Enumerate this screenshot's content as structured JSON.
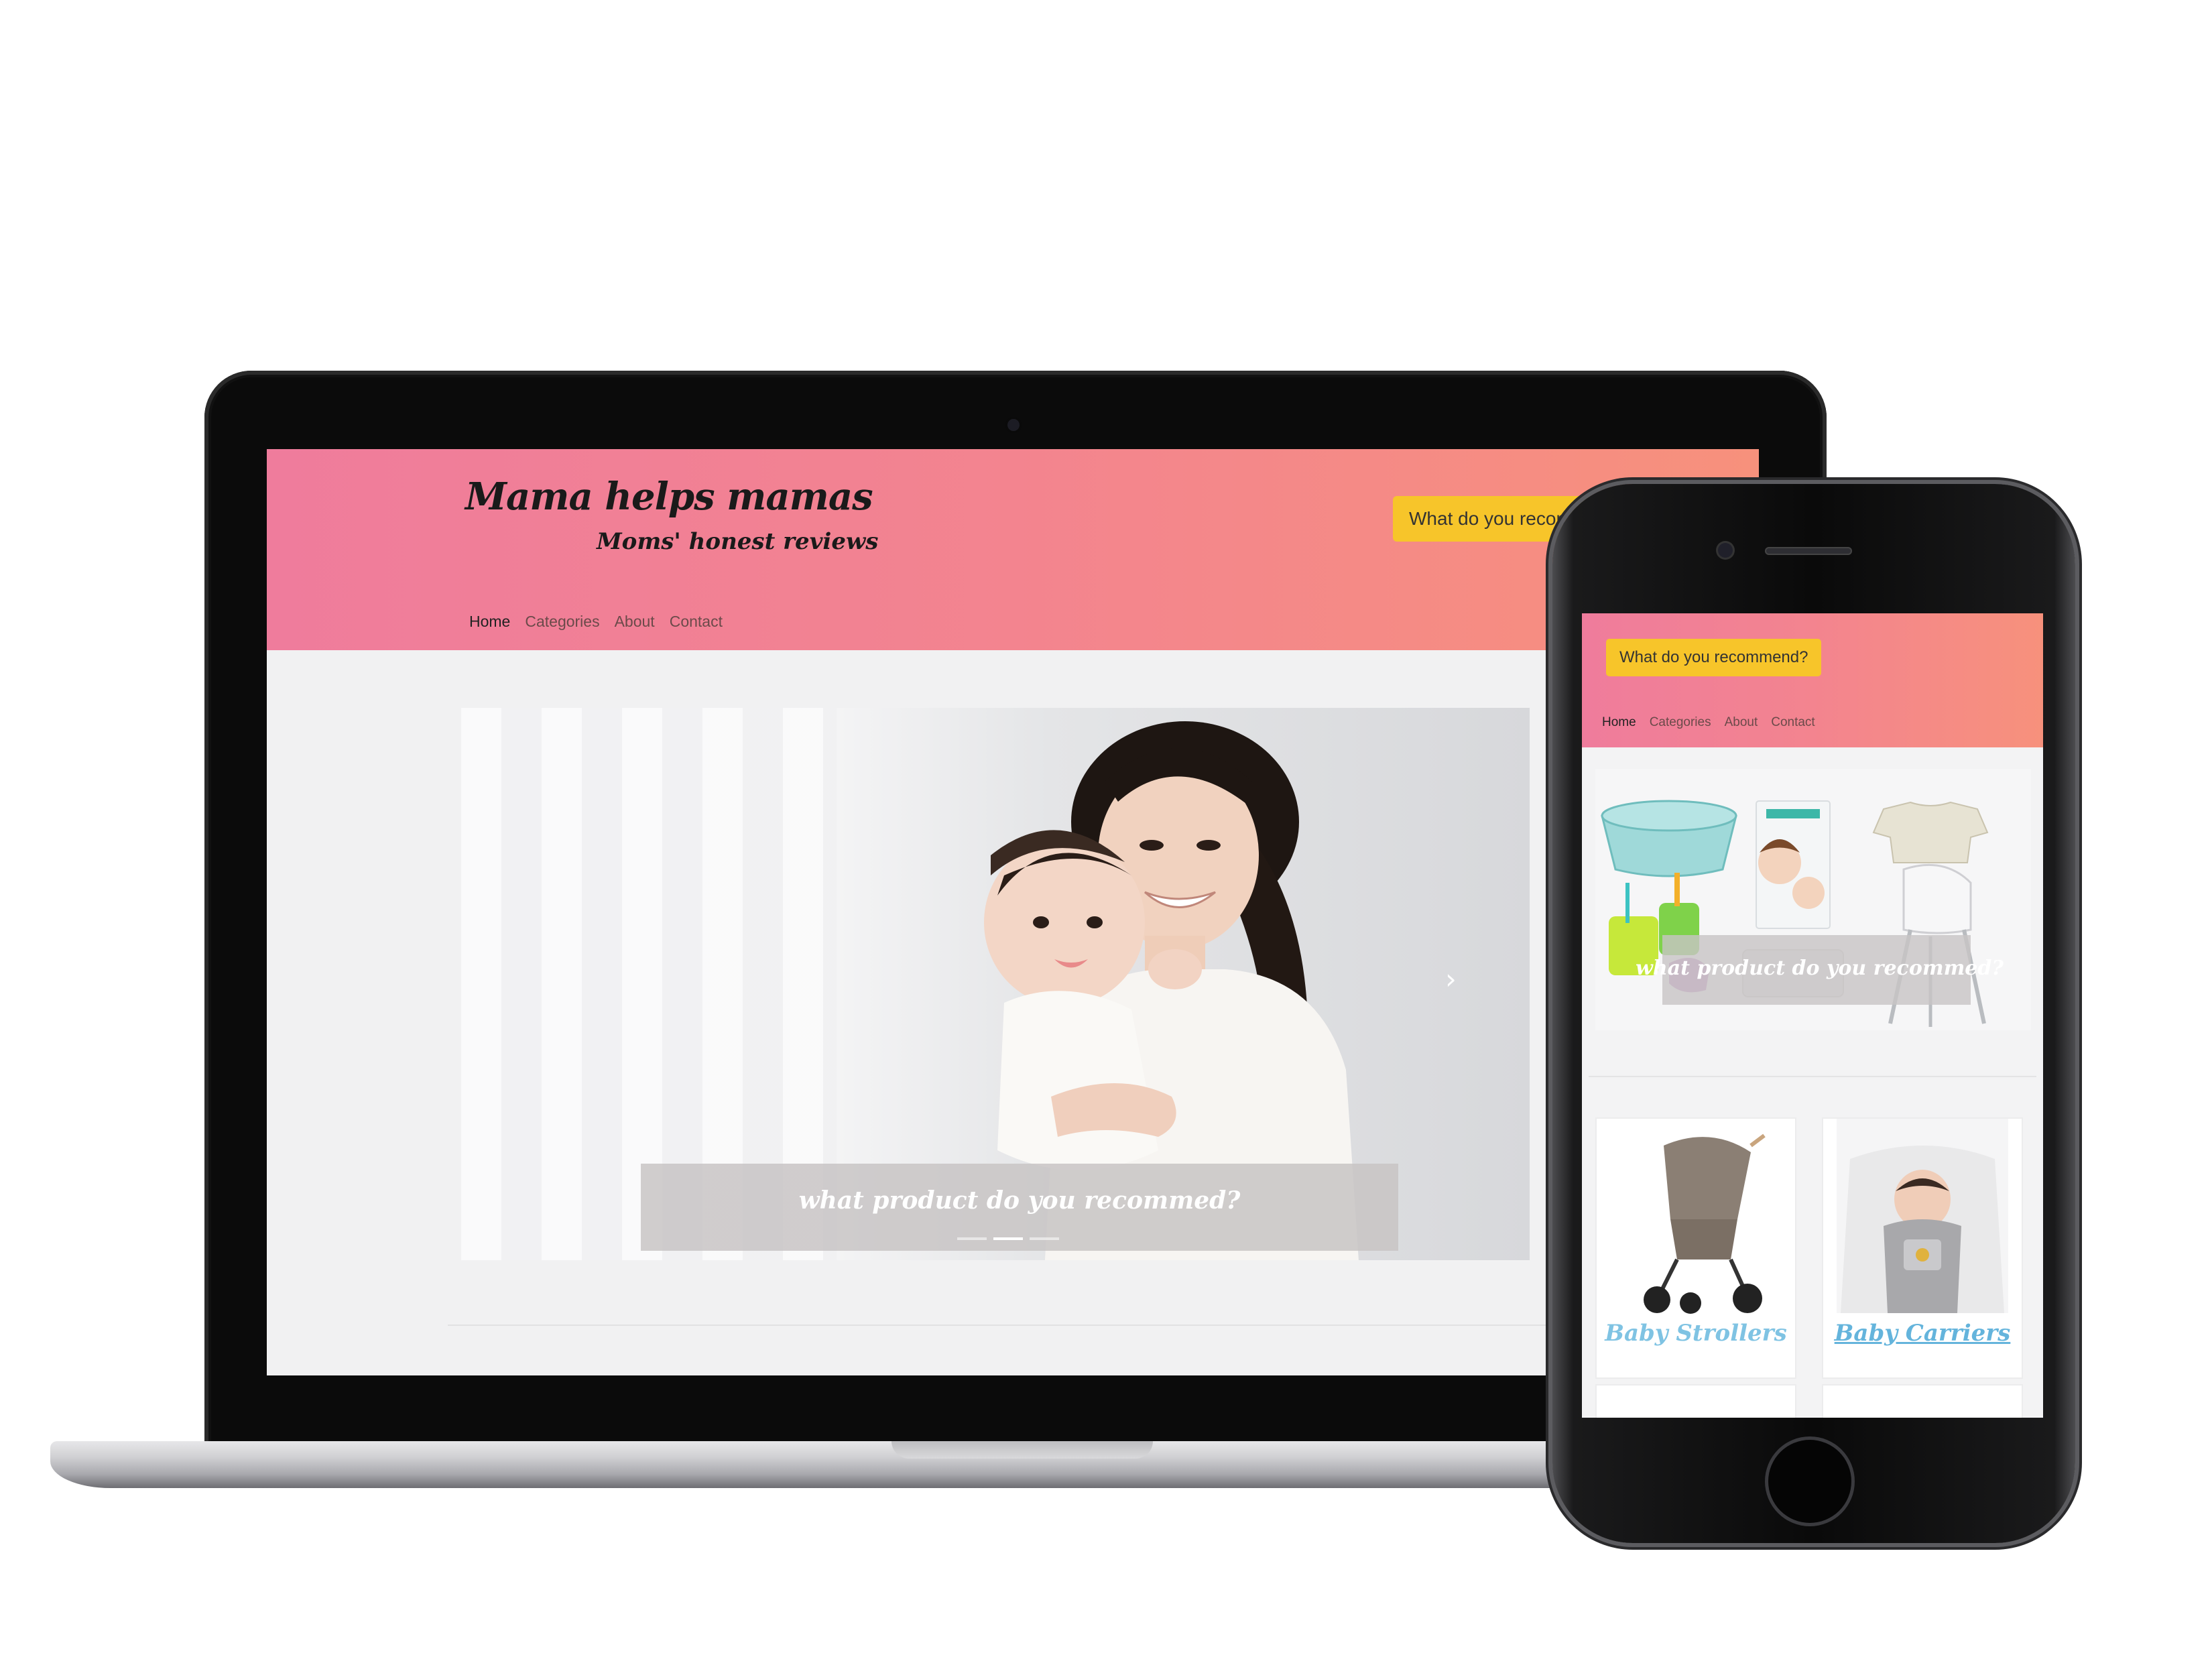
{
  "laptop": {
    "site": {
      "title": "Mama helps mamas",
      "subtitle": "Moms' honest reviews",
      "cta_label": "What do you recommend?",
      "nav": [
        "Home",
        "Categories",
        "About",
        "Contact"
      ],
      "hero_caption": "what product do you recommed?",
      "carousel_next": "›"
    }
  },
  "phone": {
    "site": {
      "cta_label": "What do you recommend?",
      "nav": [
        "Home",
        "Categories",
        "About",
        "Contact"
      ],
      "hero_caption": "what product do you recommed?",
      "categories": [
        {
          "label": "Baby Strollers"
        },
        {
          "label": "Baby Carriers"
        }
      ]
    }
  },
  "colors": {
    "header_gradient_start": "#ef7c9c",
    "header_gradient_end": "#f7917c",
    "cta_yellow": "#f7c52a",
    "category_blue": "#7fc3e3"
  }
}
